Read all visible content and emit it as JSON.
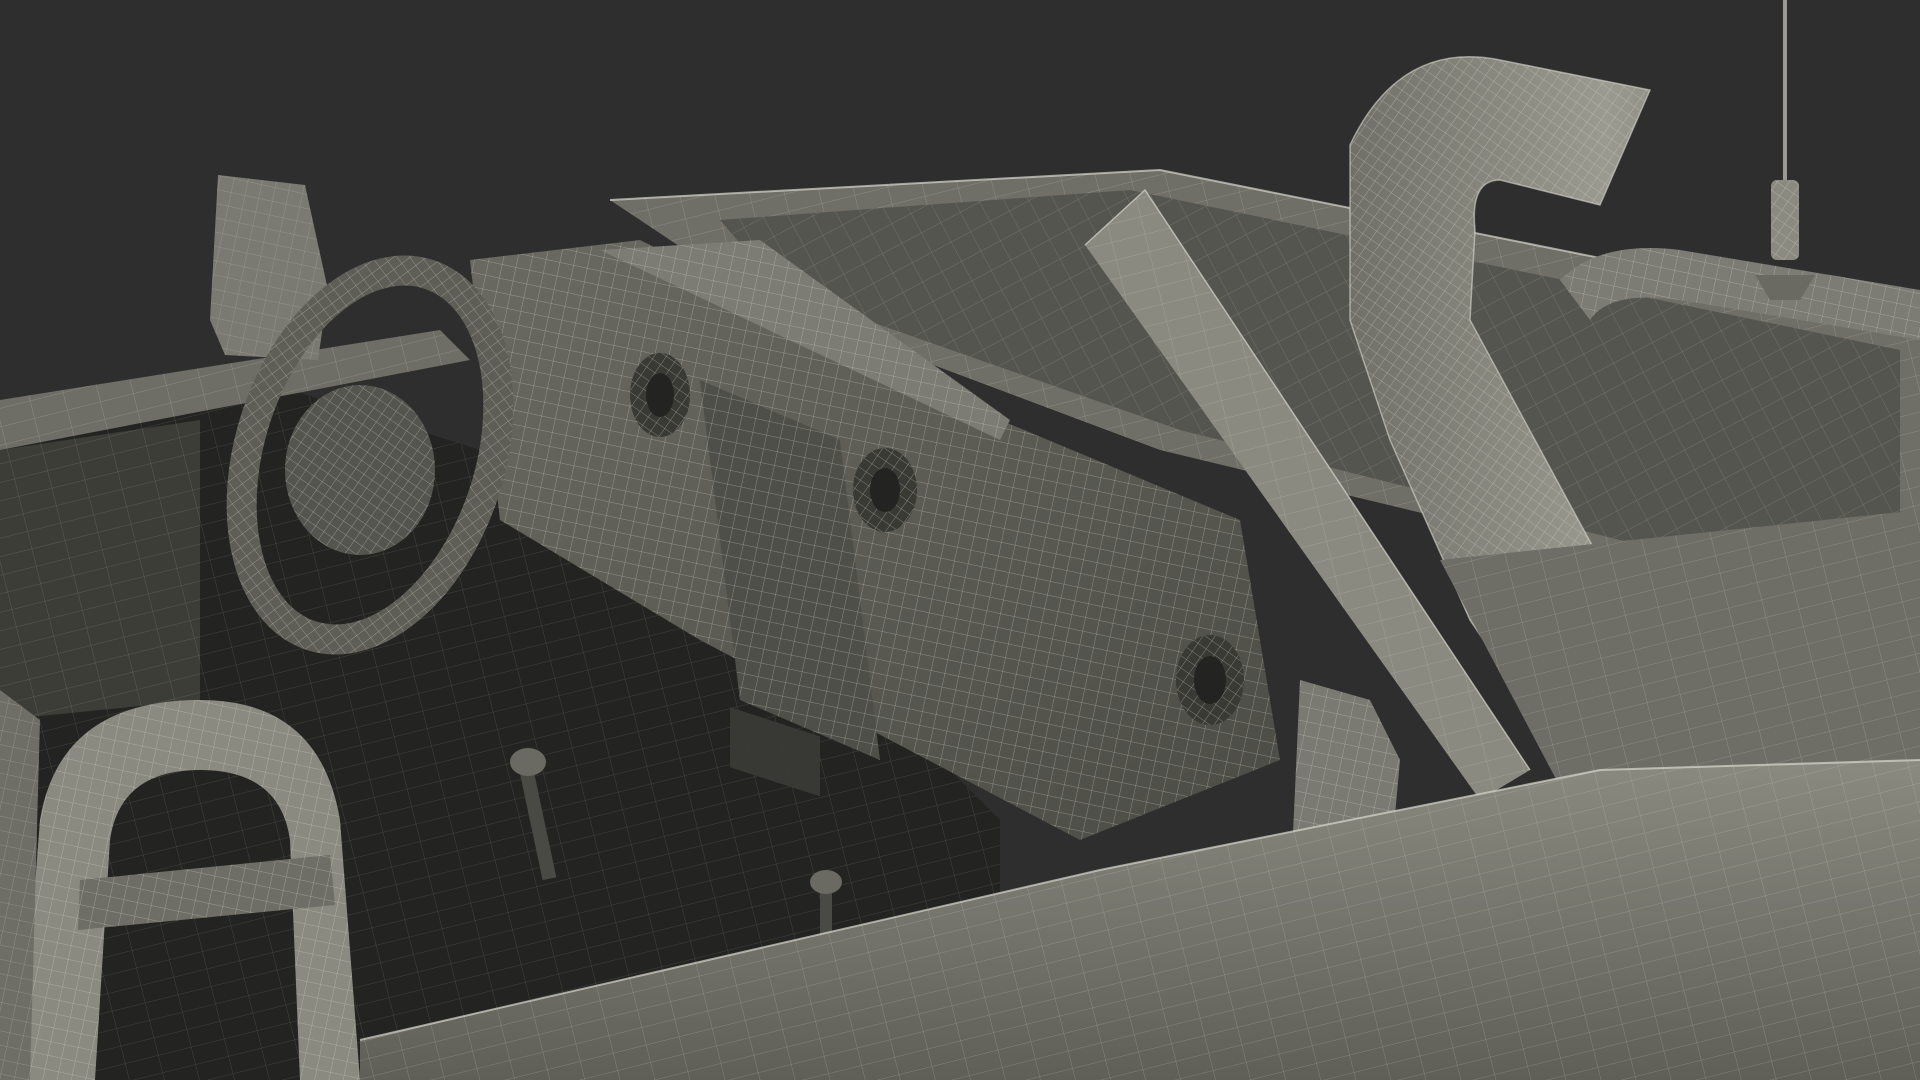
{
  "scene": {
    "subject": "wireframe-convertible-offroad-vehicle",
    "colors": {
      "background": "#2e2e2e",
      "surface_light": "#8a8a80",
      "surface_mid": "#6e6e66",
      "surface_dark": "#4a4a44",
      "interior_dark": "#232321",
      "wire": "#d8d8cf"
    }
  }
}
